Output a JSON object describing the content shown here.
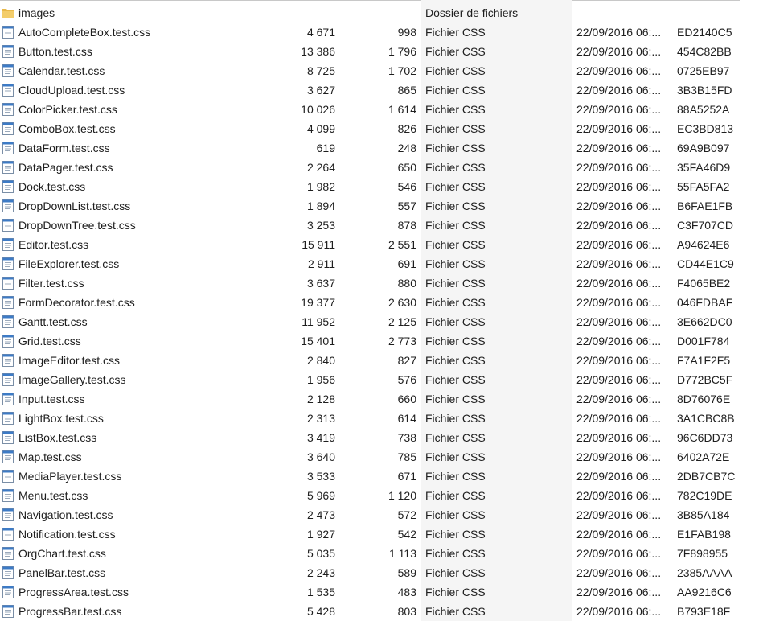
{
  "colors": {
    "text": "#1e1e1e",
    "type_column_bg": "#f5f5f5",
    "folder": "#e8b84a",
    "file_icon_bar": "#3d7bc6"
  },
  "files": [
    {
      "name": "images",
      "size": "",
      "compressed": "",
      "type": "Dossier de fichiers",
      "modified": "",
      "crc": "",
      "icon": "folder-icon"
    },
    {
      "name": "AutoCompleteBox.test.css",
      "size": "4 671",
      "compressed": "998",
      "type": "Fichier CSS",
      "modified": "22/09/2016 06:...",
      "crc": "ED2140C5",
      "icon": "css-file-icon"
    },
    {
      "name": "Button.test.css",
      "size": "13 386",
      "compressed": "1 796",
      "type": "Fichier CSS",
      "modified": "22/09/2016 06:...",
      "crc": "454C82BB",
      "icon": "css-file-icon"
    },
    {
      "name": "Calendar.test.css",
      "size": "8 725",
      "compressed": "1 702",
      "type": "Fichier CSS",
      "modified": "22/09/2016 06:...",
      "crc": "0725EB97",
      "icon": "css-file-icon"
    },
    {
      "name": "CloudUpload.test.css",
      "size": "3 627",
      "compressed": "865",
      "type": "Fichier CSS",
      "modified": "22/09/2016 06:...",
      "crc": "3B3B15FD",
      "icon": "css-file-icon"
    },
    {
      "name": "ColorPicker.test.css",
      "size": "10 026",
      "compressed": "1 614",
      "type": "Fichier CSS",
      "modified": "22/09/2016 06:...",
      "crc": "88A5252A",
      "icon": "css-file-icon"
    },
    {
      "name": "ComboBox.test.css",
      "size": "4 099",
      "compressed": "826",
      "type": "Fichier CSS",
      "modified": "22/09/2016 06:...",
      "crc": "EC3BD813",
      "icon": "css-file-icon"
    },
    {
      "name": "DataForm.test.css",
      "size": "619",
      "compressed": "248",
      "type": "Fichier CSS",
      "modified": "22/09/2016 06:...",
      "crc": "69A9B097",
      "icon": "css-file-icon"
    },
    {
      "name": "DataPager.test.css",
      "size": "2 264",
      "compressed": "650",
      "type": "Fichier CSS",
      "modified": "22/09/2016 06:...",
      "crc": "35FA46D9",
      "icon": "css-file-icon"
    },
    {
      "name": "Dock.test.css",
      "size": "1 982",
      "compressed": "546",
      "type": "Fichier CSS",
      "modified": "22/09/2016 06:...",
      "crc": "55FA5FA2",
      "icon": "css-file-icon"
    },
    {
      "name": "DropDownList.test.css",
      "size": "1 894",
      "compressed": "557",
      "type": "Fichier CSS",
      "modified": "22/09/2016 06:...",
      "crc": "B6FAE1FB",
      "icon": "css-file-icon"
    },
    {
      "name": "DropDownTree.test.css",
      "size": "3 253",
      "compressed": "878",
      "type": "Fichier CSS",
      "modified": "22/09/2016 06:...",
      "crc": "C3F707CD",
      "icon": "css-file-icon"
    },
    {
      "name": "Editor.test.css",
      "size": "15 911",
      "compressed": "2 551",
      "type": "Fichier CSS",
      "modified": "22/09/2016 06:...",
      "crc": "A94624E6",
      "icon": "css-file-icon"
    },
    {
      "name": "FileExplorer.test.css",
      "size": "2 911",
      "compressed": "691",
      "type": "Fichier CSS",
      "modified": "22/09/2016 06:...",
      "crc": "CD44E1C9",
      "icon": "css-file-icon"
    },
    {
      "name": "Filter.test.css",
      "size": "3 637",
      "compressed": "880",
      "type": "Fichier CSS",
      "modified": "22/09/2016 06:...",
      "crc": "F4065BE2",
      "icon": "css-file-icon"
    },
    {
      "name": "FormDecorator.test.css",
      "size": "19 377",
      "compressed": "2 630",
      "type": "Fichier CSS",
      "modified": "22/09/2016 06:...",
      "crc": "046FDBAF",
      "icon": "css-file-icon"
    },
    {
      "name": "Gantt.test.css",
      "size": "11 952",
      "compressed": "2 125",
      "type": "Fichier CSS",
      "modified": "22/09/2016 06:...",
      "crc": "3E662DC0",
      "icon": "css-file-icon"
    },
    {
      "name": "Grid.test.css",
      "size": "15 401",
      "compressed": "2 773",
      "type": "Fichier CSS",
      "modified": "22/09/2016 06:...",
      "crc": "D001F784",
      "icon": "css-file-icon"
    },
    {
      "name": "ImageEditor.test.css",
      "size": "2 840",
      "compressed": "827",
      "type": "Fichier CSS",
      "modified": "22/09/2016 06:...",
      "crc": "F7A1F2F5",
      "icon": "css-file-icon"
    },
    {
      "name": "ImageGallery.test.css",
      "size": "1 956",
      "compressed": "576",
      "type": "Fichier CSS",
      "modified": "22/09/2016 06:...",
      "crc": "D772BC5F",
      "icon": "css-file-icon"
    },
    {
      "name": "Input.test.css",
      "size": "2 128",
      "compressed": "660",
      "type": "Fichier CSS",
      "modified": "22/09/2016 06:...",
      "crc": "8D76076E",
      "icon": "css-file-icon"
    },
    {
      "name": "LightBox.test.css",
      "size": "2 313",
      "compressed": "614",
      "type": "Fichier CSS",
      "modified": "22/09/2016 06:...",
      "crc": "3A1CBC8B",
      "icon": "css-file-icon"
    },
    {
      "name": "ListBox.test.css",
      "size": "3 419",
      "compressed": "738",
      "type": "Fichier CSS",
      "modified": "22/09/2016 06:...",
      "crc": "96C6DD73",
      "icon": "css-file-icon"
    },
    {
      "name": "Map.test.css",
      "size": "3 640",
      "compressed": "785",
      "type": "Fichier CSS",
      "modified": "22/09/2016 06:...",
      "crc": "6402A72E",
      "icon": "css-file-icon"
    },
    {
      "name": "MediaPlayer.test.css",
      "size": "3 533",
      "compressed": "671",
      "type": "Fichier CSS",
      "modified": "22/09/2016 06:...",
      "crc": "2DB7CB7C",
      "icon": "css-file-icon"
    },
    {
      "name": "Menu.test.css",
      "size": "5 969",
      "compressed": "1 120",
      "type": "Fichier CSS",
      "modified": "22/09/2016 06:...",
      "crc": "782C19DE",
      "icon": "css-file-icon"
    },
    {
      "name": "Navigation.test.css",
      "size": "2 473",
      "compressed": "572",
      "type": "Fichier CSS",
      "modified": "22/09/2016 06:...",
      "crc": "3B85A184",
      "icon": "css-file-icon"
    },
    {
      "name": "Notification.test.css",
      "size": "1 927",
      "compressed": "542",
      "type": "Fichier CSS",
      "modified": "22/09/2016 06:...",
      "crc": "E1FAB198",
      "icon": "css-file-icon"
    },
    {
      "name": "OrgChart.test.css",
      "size": "5 035",
      "compressed": "1 113",
      "type": "Fichier CSS",
      "modified": "22/09/2016 06:...",
      "crc": "7F898955",
      "icon": "css-file-icon"
    },
    {
      "name": "PanelBar.test.css",
      "size": "2 243",
      "compressed": "589",
      "type": "Fichier CSS",
      "modified": "22/09/2016 06:...",
      "crc": "2385AAAA",
      "icon": "css-file-icon"
    },
    {
      "name": "ProgressArea.test.css",
      "size": "1 535",
      "compressed": "483",
      "type": "Fichier CSS",
      "modified": "22/09/2016 06:...",
      "crc": "AA9216C6",
      "icon": "css-file-icon"
    },
    {
      "name": "ProgressBar.test.css",
      "size": "5 428",
      "compressed": "803",
      "type": "Fichier CSS",
      "modified": "22/09/2016 06:...",
      "crc": "B793E18F",
      "icon": "css-file-icon"
    }
  ]
}
